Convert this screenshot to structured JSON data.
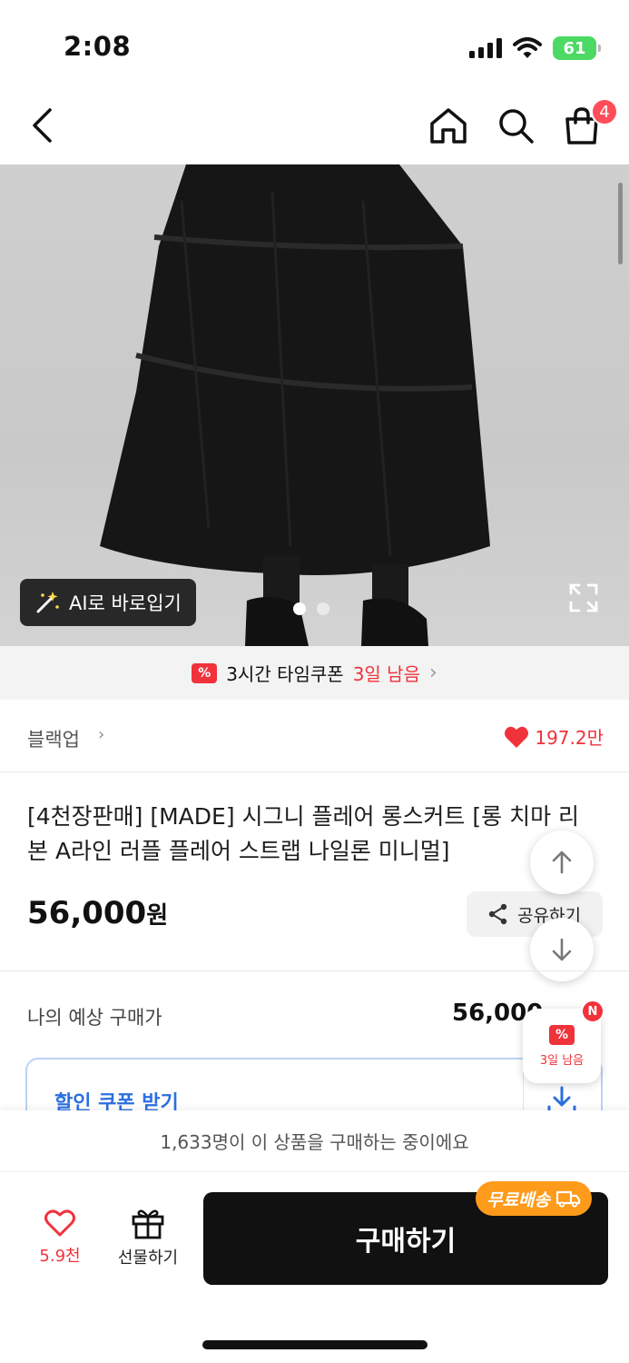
{
  "status_bar": {
    "time": "2:08",
    "battery": "61"
  },
  "header": {
    "cart_count": "4"
  },
  "gallery": {
    "ai_fit_label": "AI로 바로입기",
    "page_count": 2,
    "active_page": 1
  },
  "time_coupon": {
    "text": "3시간 타임쿠폰",
    "remaining": "3일 남음"
  },
  "brand": {
    "name": "블랙업",
    "likes": "197.2만"
  },
  "product": {
    "title": "[4천장판매] [MADE] 시그니 플레어 롱스커트 [롱 치마 리본 A라인 러플 플레어 스트랩 나일론 미니멀]",
    "price": "56,000",
    "price_unit": "원",
    "share_label": "공유하기"
  },
  "expected": {
    "label": "나의 예상 구매가",
    "value": "56,000"
  },
  "coupon_float": {
    "label": "3일 남음",
    "badge": "N"
  },
  "coupon_box": {
    "label": "할인 쿠폰 받기"
  },
  "buyers_text": "1,633명이 이 상품을 구매하는 중이에요",
  "bottom": {
    "wish_count": "5.9천",
    "gift_label": "선물하기",
    "buy_label": "구매하기",
    "free_shipping": "무료배송"
  },
  "colors": {
    "accent_red": "#f0323b",
    "buy_button": "#111111",
    "free_ship": "#ff9b1a",
    "coupon_blue": "#2c6fe0"
  }
}
